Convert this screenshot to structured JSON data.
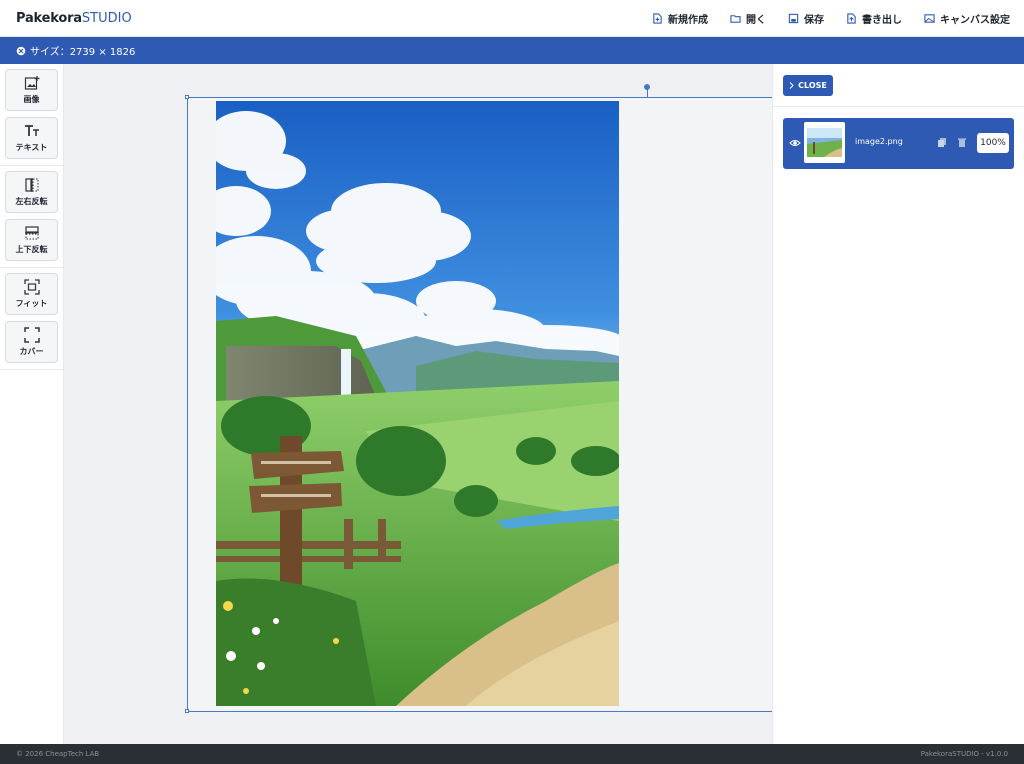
{
  "header": {
    "brand_bold": "Pakekora",
    "brand_light": "STUDIO",
    "menu": [
      {
        "label": "新規作成",
        "icon": "new-file-icon"
      },
      {
        "label": "開く",
        "icon": "folder-open-icon"
      },
      {
        "label": "保存",
        "icon": "save-icon"
      },
      {
        "label": "書き出し",
        "icon": "export-icon"
      },
      {
        "label": "キャンバス設定",
        "icon": "canvas-settings-icon"
      }
    ]
  },
  "infobar": {
    "size_text": "サイズ：2739 × 1826",
    "icon": "canvas-size-icon"
  },
  "toolbar": {
    "tools": [
      {
        "label": "画像",
        "icon": "add-image-icon"
      },
      {
        "label": "テキスト",
        "icon": "text-icon"
      },
      {
        "label": "左右反転",
        "icon": "flip-horizontal-icon"
      },
      {
        "label": "上下反転",
        "icon": "flip-vertical-icon"
      },
      {
        "label": "フィット",
        "icon": "fit-icon"
      },
      {
        "label": "カバー",
        "icon": "cover-icon"
      }
    ]
  },
  "panel": {
    "close_label": "CLOSE",
    "layers": [
      {
        "name": "image2.png",
        "opacity": "100%",
        "visible": true
      }
    ]
  },
  "footer": {
    "left": "© 2026 CheapTech LAB",
    "right": "PakekoraSTUDIO - v1.0.0"
  },
  "colors": {
    "accent": "#2f5ab3",
    "footer_bg": "#2a2e35",
    "canvas_bg": "#eef0f3",
    "selection": "#4a78c8"
  }
}
